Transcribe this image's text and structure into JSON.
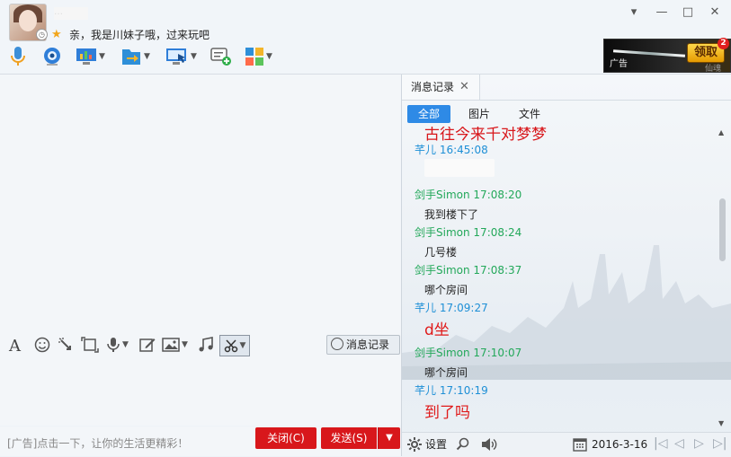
{
  "contact": {
    "name": "…",
    "signature": "亲，我是川妹子哦，过来玩吧"
  },
  "window_controls": [
    "▾",
    "—",
    "□",
    "✕"
  ],
  "ad": {
    "label": "广告",
    "claim": "领取",
    "count": "2",
    "sub": "仙魂"
  },
  "input": {
    "history_label": "消息记录",
    "ad_text": "[广告]点击一下，让你的生活更精彩！",
    "close_label": "关闭(C)",
    "send_label": "发送(S)"
  },
  "history": {
    "tab_label": "消息记录",
    "filters": [
      "全部",
      "图片",
      "文件"
    ],
    "messages": [
      {
        "sender": "",
        "time": "",
        "text": "古往今来千对梦梦",
        "style": "big",
        "color": "#1e8fd6"
      },
      {
        "sender": "芊儿",
        "time": "16:45:08",
        "text": "",
        "style": "normal",
        "color": "#1e8fd6"
      },
      {
        "sender": "",
        "time": "",
        "text": "…",
        "style": "big",
        "color": "#1e8fd6"
      },
      {
        "sender": "剑手Simon",
        "time": "17:08:20",
        "text": "我到楼下了",
        "style": "normal",
        "color": "#23a85a"
      },
      {
        "sender": "剑手Simon",
        "time": "17:08:24",
        "text": "几号楼",
        "style": "normal",
        "color": "#23a85a"
      },
      {
        "sender": "剑手Simon",
        "time": "17:08:37",
        "text": "哪个房间",
        "style": "normal",
        "color": "#23a85a"
      },
      {
        "sender": "芊儿",
        "time": "17:09:27",
        "text": "d坐",
        "style": "big",
        "color": "#1e8fd6"
      },
      {
        "sender": "剑手Simon",
        "time": "17:10:07",
        "text": "哪个房间",
        "style": "normal",
        "color": "#23a85a"
      },
      {
        "sender": "芊儿",
        "time": "17:10:19",
        "text": "到了吗",
        "style": "big",
        "color": "#1e8fd6"
      }
    ],
    "settings_label": "设置",
    "date": "2016-3-16",
    "nav": [
      "|◁",
      "◁",
      "▷",
      "▷|"
    ]
  },
  "colors": {
    "accent_blue": "#2e8ae6",
    "send_red": "#d8171b",
    "sender_green": "#23a85a",
    "sender_blue": "#1e8fd6",
    "message_red": "#e01a1a"
  },
  "icons": {
    "toolbar": [
      "microphone-icon",
      "camera-icon",
      "screen-share-icon",
      "file-transfer-icon",
      "remote-desktop-icon",
      "add-chat-icon",
      "apps-icon"
    ],
    "input_toolbar": [
      "font-icon",
      "emoji-icon",
      "nudge-icon",
      "screenshot-icon",
      "voice-message-icon",
      "edit-icon",
      "image-icon",
      "music-icon",
      "scissors-icon"
    ]
  }
}
